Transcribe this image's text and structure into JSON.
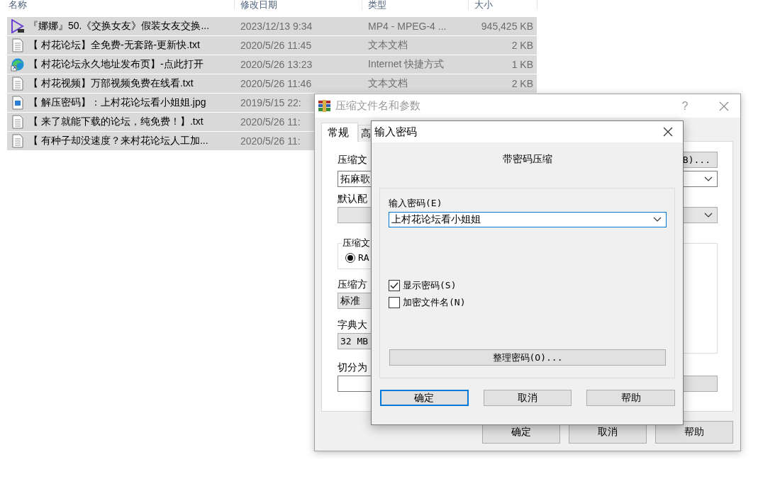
{
  "file_list": {
    "columns": [
      "名称",
      "修改日期",
      "类型",
      "大小"
    ],
    "rows": [
      {
        "kind": "video",
        "name": "『娜娜』50.《交换女友》假装女友交换...",
        "date": "2023/12/13 9:34",
        "type": "MP4 - MPEG-4 ...",
        "size": "945,425 KB",
        "selected": true
      },
      {
        "kind": "text",
        "name": "【 村花论坛】全免费-无套路-更新快.txt",
        "date": "2020/5/26 11:45",
        "type": "文本文档",
        "size": "2 KB",
        "selected": true
      },
      {
        "kind": "web",
        "name": "【 村花论坛永久地址发布页】-点此打开",
        "date": "2020/5/26 13:23",
        "type": "Internet 快捷方式",
        "size": "1 KB",
        "selected": true
      },
      {
        "kind": "text",
        "name": "【 村花视频】万部视频免费在线看.txt",
        "date": "2020/5/26 11:46",
        "type": "文本文档",
        "size": "2 KB",
        "selected": true
      },
      {
        "kind": "image",
        "name": "【 解压密码】：上村花论坛看小姐姐.jpg",
        "date": "2019/5/15 22:",
        "selected": true
      },
      {
        "kind": "text",
        "name": "【 来了就能下载的论坛，纯免费！】.txt",
        "date": "2020/5/26 11:",
        "selected": true
      },
      {
        "kind": "text",
        "name": "【 有种子却没速度？来村花论坛人工加...",
        "date": "2020/5/26 11:",
        "selected": true
      }
    ]
  },
  "archive_dialog": {
    "title": "压缩文件名和参数",
    "help": "?",
    "tabs": [
      {
        "label": "常规",
        "selected": true
      },
      {
        "label": "高",
        "selected": false
      }
    ],
    "archive_name_label": "压缩文",
    "browse_button": "B)...",
    "archive_name": "拓麻歌",
    "profile_label": "默认配",
    "format_group": "压缩文",
    "format_option": {
      "label": "RA",
      "selected": true
    },
    "method_label": "压缩方",
    "method": "标准",
    "dictionary_label": "字典大",
    "dictionary": "32 MB",
    "split_label": "切分为",
    "buttons": [
      "确定",
      "取消",
      "帮助"
    ]
  },
  "password_dialog": {
    "title": "输入密码",
    "heading": "带密码压缩",
    "password_label": "输入密码(E)",
    "password": "上村花论坛看小姐姐",
    "options": [
      {
        "label": "显示密码(S)",
        "checked": true
      },
      {
        "label": "加密文件名(N)",
        "checked": false
      }
    ],
    "organize_button": "整理密码(O)...",
    "buttons": [
      {
        "label": "确定",
        "focused": true
      },
      {
        "label": "取消",
        "focused": false
      },
      {
        "label": "帮助",
        "focused": false
      }
    ]
  }
}
